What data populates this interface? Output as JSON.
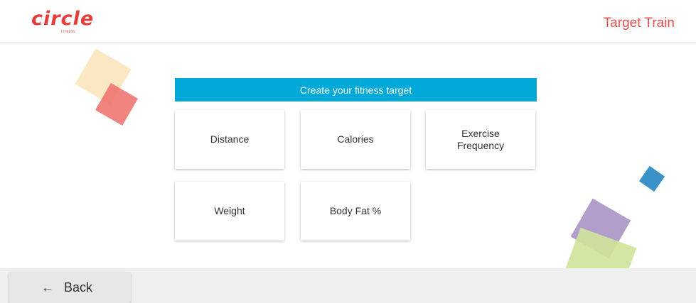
{
  "header": {
    "logo_text": "circle",
    "logo_subtext": "FITNESS",
    "title": "Target Train"
  },
  "main": {
    "banner": "Create your fitness target",
    "targets": [
      {
        "label": "Distance"
      },
      {
        "label": "Calories"
      },
      {
        "label": "Exercise\nFrequency"
      },
      {
        "label": "Weight"
      },
      {
        "label": "Body Fat %"
      }
    ]
  },
  "footer": {
    "back_label": "Back",
    "back_icon": "arrow-left-icon"
  },
  "colors": {
    "brand_red": "#e53c3c",
    "banner_blue": "#00a9d7",
    "footer_bg": "#efefef"
  }
}
